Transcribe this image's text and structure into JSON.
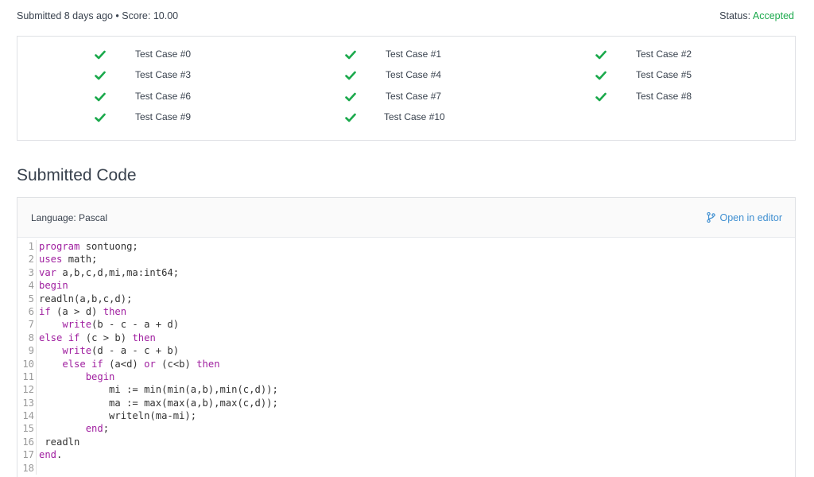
{
  "header": {
    "submission_info": "Submitted 8 days ago • Score: 10.00",
    "status_label": "Status:",
    "status_value": "Accepted",
    "status_color": "#1ba94c"
  },
  "test_cases": [
    {
      "label": "Test Case #0",
      "passed": true
    },
    {
      "label": "Test Case #1",
      "passed": true
    },
    {
      "label": "Test Case #2",
      "passed": true
    },
    {
      "label": "Test Case #3",
      "passed": true
    },
    {
      "label": "Test Case #4",
      "passed": true
    },
    {
      "label": "Test Case #5",
      "passed": true
    },
    {
      "label": "Test Case #6",
      "passed": true
    },
    {
      "label": "Test Case #7",
      "passed": true
    },
    {
      "label": "Test Case #8",
      "passed": true
    },
    {
      "label": "Test Case #9",
      "passed": true
    },
    {
      "label": "Test Case #10",
      "passed": true
    }
  ],
  "check_icon": "check-icon",
  "section_title": "Submitted Code",
  "code_panel": {
    "language_label": "Language: Pascal",
    "open_editor_label": "Open in editor",
    "open_editor_icon": "branch-icon",
    "accent_color": "#3f8fd1"
  },
  "code_lines": [
    {
      "n": "1",
      "parts": [
        [
          "kw",
          "program"
        ],
        [
          "",
          " sontuong;"
        ]
      ]
    },
    {
      "n": "2",
      "parts": [
        [
          "kw",
          "uses"
        ],
        [
          "",
          " math;"
        ]
      ]
    },
    {
      "n": "3",
      "parts": [
        [
          "kw",
          "var"
        ],
        [
          "",
          " a,b,c,d,mi,ma:int64;"
        ]
      ]
    },
    {
      "n": "4",
      "parts": [
        [
          "kw",
          "begin"
        ]
      ]
    },
    {
      "n": "5",
      "parts": [
        [
          "",
          "readln(a,b,c,d);"
        ]
      ]
    },
    {
      "n": "6",
      "parts": [
        [
          "kw",
          "if"
        ],
        [
          "",
          " (a > d) "
        ],
        [
          "kw",
          "then"
        ]
      ]
    },
    {
      "n": "7",
      "parts": [
        [
          "",
          "    "
        ],
        [
          "kw",
          "write"
        ],
        [
          "",
          "(b - c - a + d)"
        ]
      ]
    },
    {
      "n": "8",
      "parts": [
        [
          "kw",
          "else"
        ],
        [
          "",
          " "
        ],
        [
          "kw",
          "if"
        ],
        [
          "",
          " (c > b) "
        ],
        [
          "kw",
          "then"
        ]
      ]
    },
    {
      "n": "9",
      "parts": [
        [
          "",
          "    "
        ],
        [
          "kw",
          "write"
        ],
        [
          "",
          "(d - a - c + b)"
        ]
      ]
    },
    {
      "n": "10",
      "parts": [
        [
          "",
          "    "
        ],
        [
          "kw",
          "else"
        ],
        [
          "",
          " "
        ],
        [
          "kw",
          "if"
        ],
        [
          "",
          " (a<d) "
        ],
        [
          "kw",
          "or"
        ],
        [
          "",
          " (c<b) "
        ],
        [
          "kw",
          "then"
        ]
      ]
    },
    {
      "n": "11",
      "parts": [
        [
          "",
          "        "
        ],
        [
          "kw",
          "begin"
        ]
      ]
    },
    {
      "n": "12",
      "parts": [
        [
          "",
          "            mi := min(min(a,b),min(c,d));"
        ]
      ]
    },
    {
      "n": "13",
      "parts": [
        [
          "",
          "            ma := max(max(a,b),max(c,d));"
        ]
      ]
    },
    {
      "n": "14",
      "parts": [
        [
          "",
          "            writeln(ma-mi);"
        ]
      ]
    },
    {
      "n": "15",
      "parts": [
        [
          "",
          "        "
        ],
        [
          "kw",
          "end"
        ],
        [
          "",
          ";"
        ]
      ]
    },
    {
      "n": "16",
      "parts": [
        [
          "",
          " readln"
        ]
      ]
    },
    {
      "n": "17",
      "parts": [
        [
          "kw",
          "end"
        ],
        [
          "",
          "."
        ]
      ]
    },
    {
      "n": "18",
      "parts": []
    }
  ]
}
